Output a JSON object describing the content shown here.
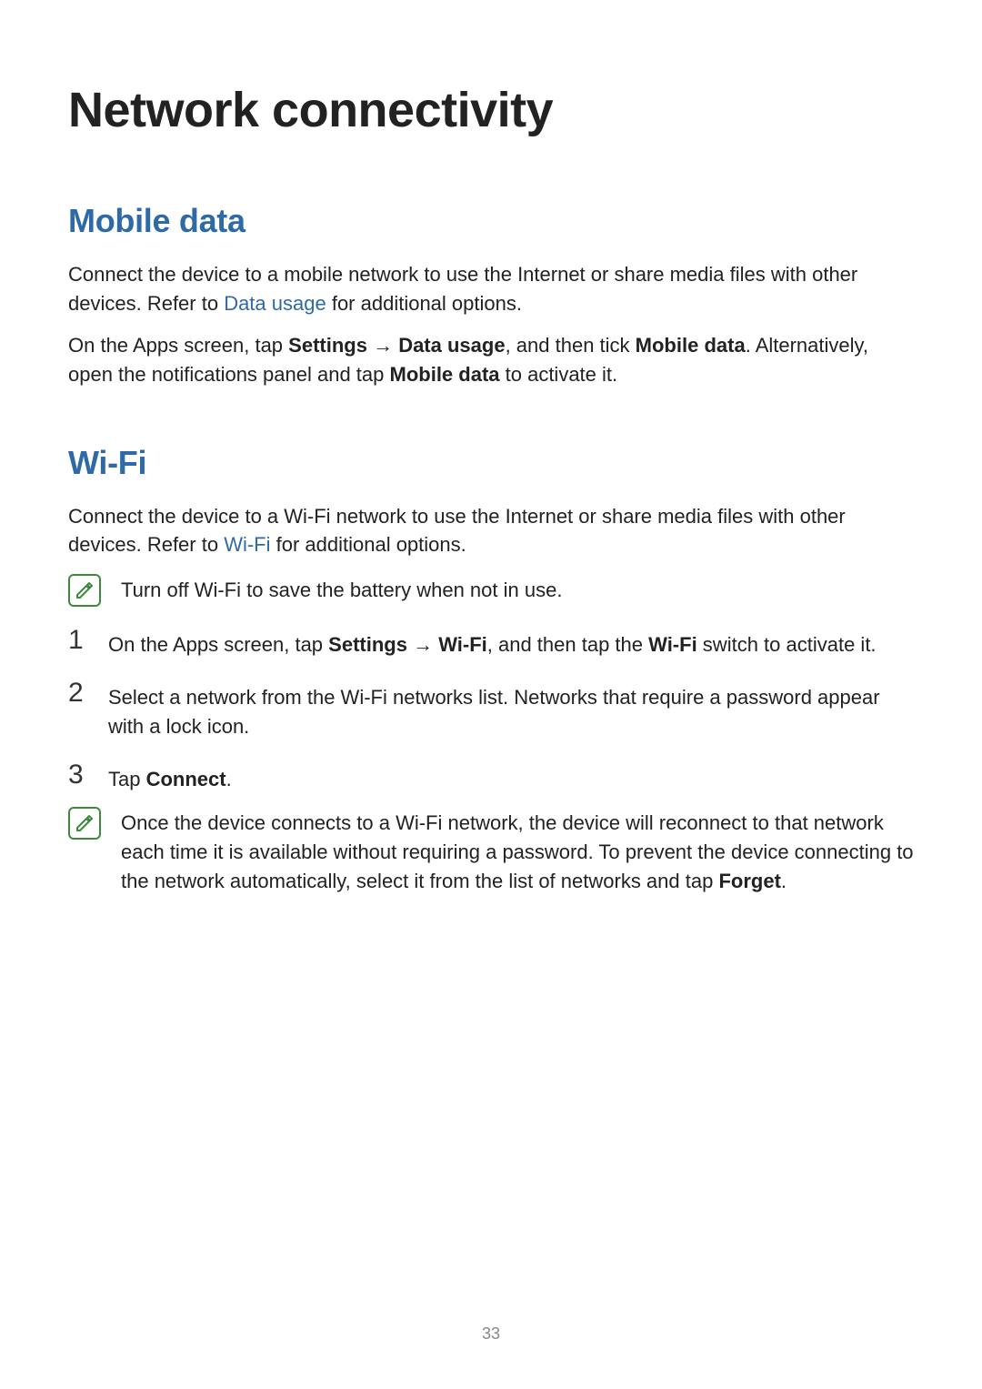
{
  "page_number": "33",
  "title": "Network connectivity",
  "sections": {
    "mobile": {
      "heading": "Mobile data",
      "p1_a": "Connect the device to a mobile network to use the Internet or share media files with other devices. Refer to ",
      "p1_link": "Data usage",
      "p1_b": " for additional options.",
      "p2_a": "On the Apps screen, tap ",
      "p2_b1": "Settings",
      "p2_arrow": " → ",
      "p2_b2": "Data usage",
      "p2_c": ", and then tick ",
      "p2_b3": "Mobile data",
      "p2_d": ". Alternatively, open the notifications panel and tap ",
      "p2_b4": "Mobile data",
      "p2_e": " to activate it."
    },
    "wifi": {
      "heading": "Wi-Fi",
      "p1_a": "Connect the device to a Wi-Fi network to use the Internet or share media files with other devices. Refer to ",
      "p1_link": "Wi-Fi",
      "p1_b": " for additional options.",
      "note1": "Turn off Wi-Fi to save the battery when not in use.",
      "step1_num": "1",
      "step1_a": "On the Apps screen, tap ",
      "step1_b1": "Settings",
      "step1_arrow": " → ",
      "step1_b2": "Wi-Fi",
      "step1_c": ", and then tap the ",
      "step1_b3": "Wi-Fi",
      "step1_d": " switch to activate it.",
      "step2_num": "2",
      "step2": "Select a network from the Wi-Fi networks list. Networks that require a password appear with a lock icon.",
      "step3_num": "3",
      "step3_a": "Tap ",
      "step3_b": "Connect",
      "step3_c": ".",
      "note2_a": "Once the device connects to a Wi-Fi network, the device will reconnect to that network each time it is available without requiring a password. To prevent the device connecting to the network automatically, select it from the list of networks and tap ",
      "note2_b": "Forget",
      "note2_c": "."
    }
  }
}
